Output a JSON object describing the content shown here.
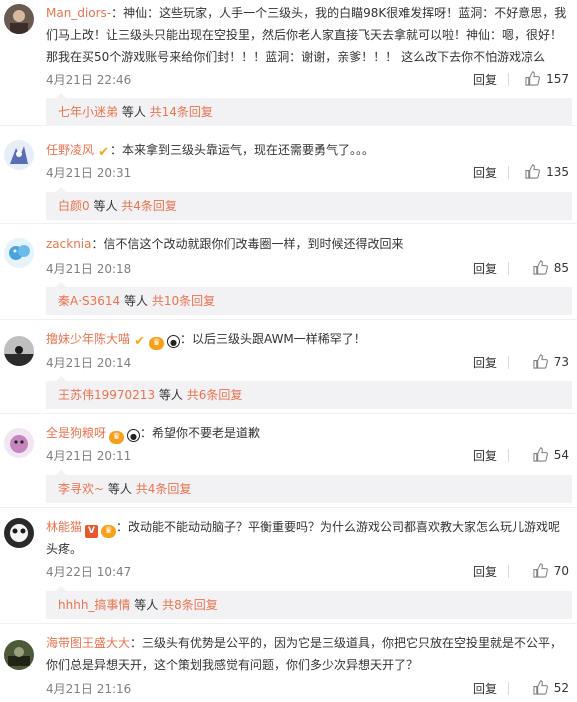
{
  "comments": [
    {
      "user": "Man_diors-",
      "text_lines": [
        "：神仙：这些玩家，人手一个三级头，我的白瞄98K很难发挥呀！蓝洞：不好意思，我",
        "们马上改！让三级头只能出现在空投里，然后你老人家直接飞天去拿就可以啦！神仙：嗯，很好！",
        "那我在买50个游戏账号来给你们封！！！蓝洞：谢谢，亲爹！！！     这么改下去你不怕游戏凉么"
      ],
      "time": "4月21日 22:46",
      "reply": "回复",
      "likes": "157",
      "sub_user": "七年小迷弟",
      "sub_mid": " 等人 ",
      "sub_count": "共14条回复"
    },
    {
      "user": "任野凌风",
      "text_lines": [
        "：本来拿到三级头靠运气，现在还需要勇气了。。。"
      ],
      "time": "4月21日 20:31",
      "reply": "回复",
      "likes": "135",
      "sub_user": "白颜0",
      "sub_mid": " 等人 ",
      "sub_count": "共4条回复"
    },
    {
      "user": "zacknia",
      "text_lines": [
        "：信不信这个改动就跟你们改毒圈一样，到时候还得改回来"
      ],
      "time": "4月21日 20:18",
      "reply": "回复",
      "likes": "85",
      "sub_user": "秦A·S3614",
      "sub_mid": " 等人 ",
      "sub_count": "共10条回复"
    },
    {
      "user": "撸妹少年陈大喵",
      "text_lines": [
        "：以后三级头跟AWM一样稀罕了！"
      ],
      "time": "4月21日 20:14",
      "reply": "回复",
      "likes": "73",
      "sub_user": "王苏伟19970213",
      "sub_mid": " 等人 ",
      "sub_count": "共6条回复"
    },
    {
      "user": "全是狗粮呀",
      "text_lines": [
        "：希望你不要老是道歉"
      ],
      "time": "4月21日 20:11",
      "reply": "回复",
      "likes": "54",
      "sub_user": "李寻欢~",
      "sub_mid": " 等人 ",
      "sub_count": "共4条回复"
    },
    {
      "user": "林能猫",
      "text_lines": [
        "：改动能不能动动脑子？平衡重要吗？为什么游戏公司都喜欢教大家怎么玩儿游戏呢",
        "头疼。"
      ],
      "time": "4月22日 10:47",
      "reply": "回复",
      "likes": "70",
      "sub_user": "hhhh_搞事情",
      "sub_mid": " 等人 ",
      "sub_count": "共8条回复"
    },
    {
      "user": "海带图王盛大大",
      "text_lines": [
        "：三级头有优势是公平的，因为它是三级道具，你把它只放在空投里就是不公平，",
        "你们总是异想天开，这个策划我感觉有问题，你们多少次异想天开了？"
      ],
      "time": "4月21日 21:16",
      "reply": "回复",
      "likes": "52"
    }
  ],
  "colors": {
    "username": "#eb7350",
    "meta": "#808080",
    "sub_bg": "#f2f2f5"
  },
  "icons": {
    "like": "thumbs-up-icon",
    "verified": "verified-v-icon",
    "level": "level-badge-icon",
    "panda": "panda-badge-icon"
  }
}
